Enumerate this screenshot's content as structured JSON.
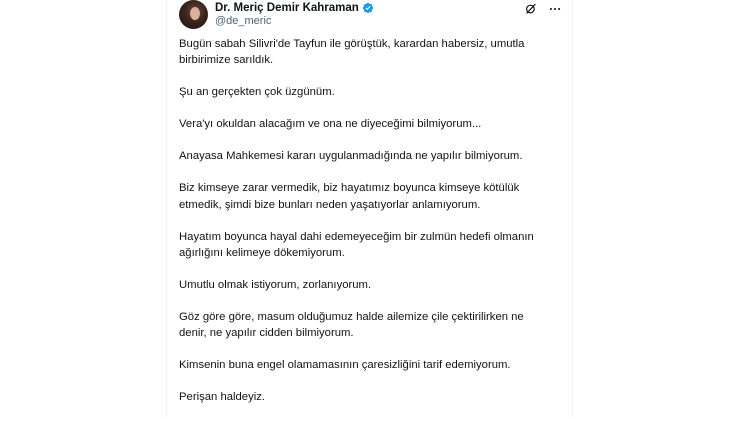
{
  "tweet": {
    "author": {
      "display_name": "Dr. Meriç Demir Kahraman",
      "handle": "@de_meric",
      "verified": true,
      "verified_color": "#1d9bf0"
    },
    "icons": {
      "verified": "verified-badge-icon",
      "grok": "grok-icon",
      "more": "more-icon"
    },
    "paragraphs": [
      "Bugün sabah Silivri'de Tayfun ile görüştük, karardan habersiz, umutla\nbirbirimize sarıldık.",
      "Şu an gerçekten çok üzgünüm.",
      "Vera'yı okuldan alacağım ve ona ne diyeceğimi bilmiyorum...",
      "Anayasa Mahkemesi kararı uygulanmadığında ne yapılır bilmiyorum.",
      "Biz kimseye zarar vermedik, biz hayatımız boyunca kimseye kötülük\netmedik, şimdi bize bunları neden yaşatıyorlar anlamıyorum.",
      "Hayatım boyunca hayal dahi edemeyeceğim bir zulmün hedefi olmanın\nağırlığını kelimeye dökemiyorum.",
      "Umutlu olmak istiyorum, zorlanıyorum.",
      "Göz göre göre, masum olduğumuz halde ailemize çile çektirilirken ne\ndenir, ne yapılır cidden bilmiyorum.",
      "Kimsenin buna engel olamamasının çaresizliğini tarif edemiyorum.",
      "Perişan haldeyiz."
    ]
  }
}
